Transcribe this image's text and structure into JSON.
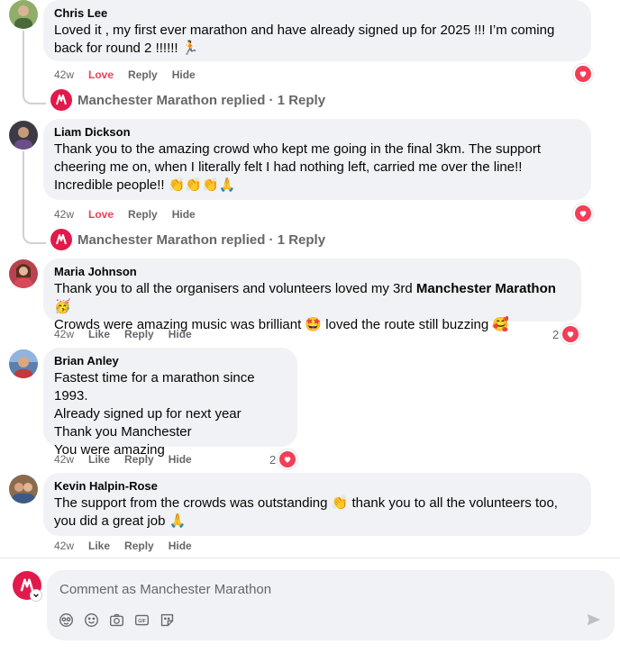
{
  "comments": [
    {
      "author": "Chris Lee",
      "lines": [
        "Loved it , my first ever marathon and have already signed up for 2025 !!! I’m coming",
        "back for round 2 !!!!!! 🏃"
      ],
      "time": "42w",
      "like_label": "Love",
      "reply_label": "Reply",
      "hide_label": "Hide",
      "reaction_count": "",
      "replied_text": "Manchester Marathon replied · 1 Reply"
    },
    {
      "author": "Liam Dickson",
      "lines": [
        "Thank you to the amazing crowd who kept me going in the final 3km. The support",
        "cheering me on, when I literally felt I had nothing left, carried me over the line!!",
        "Incredible people!! 👏👏👏🙏"
      ],
      "time": "42w",
      "like_label": "Love",
      "reply_label": "Reply",
      "hide_label": "Hide",
      "reaction_count": "",
      "replied_text": "Manchester Marathon replied · 1 Reply"
    },
    {
      "author": "Maria Johnson",
      "line1_pre": "Thank you to all the organisers and volunteers loved my 3rd ",
      "line1_strong": "Manchester Marathon",
      "line1_post": " 🥳",
      "line2": "Crowds were amazing music was brilliant 🤩 loved the route still buzzing 🥰",
      "time": "42w",
      "like_label": "Like",
      "reply_label": "Reply",
      "hide_label": "Hide",
      "reaction_count": "2"
    },
    {
      "author": "Brian Anley",
      "lines": [
        "Fastest time for a marathon since 1993.",
        "Already signed up for next year",
        "Thank you Manchester",
        "You were amazing"
      ],
      "time": "42w",
      "like_label": "Like",
      "reply_label": "Reply",
      "hide_label": "Hide",
      "reaction_count": "2"
    },
    {
      "author": "Kevin Halpin-Rose",
      "lines": [
        "The support from the crowds was outstanding 👏 thank you to all the volunteers too,",
        "you did a great job 🙏"
      ],
      "time": "42w",
      "like_label": "Like",
      "reply_label": "Reply",
      "hide_label": "Hide",
      "reaction_count": ""
    }
  ],
  "composer": {
    "placeholder": "Comment as Manchester Marathon"
  },
  "colors": {
    "bubble": "#f0f2f5",
    "secondary_text": "#65676b",
    "love": "#f33e58",
    "brand": "#e2194b"
  },
  "icons": [
    "heart-icon",
    "avatar-sticker-icon",
    "emoji-icon",
    "camera-icon",
    "gif-icon",
    "sticker-icon",
    "send-icon",
    "chevron-down-icon"
  ]
}
